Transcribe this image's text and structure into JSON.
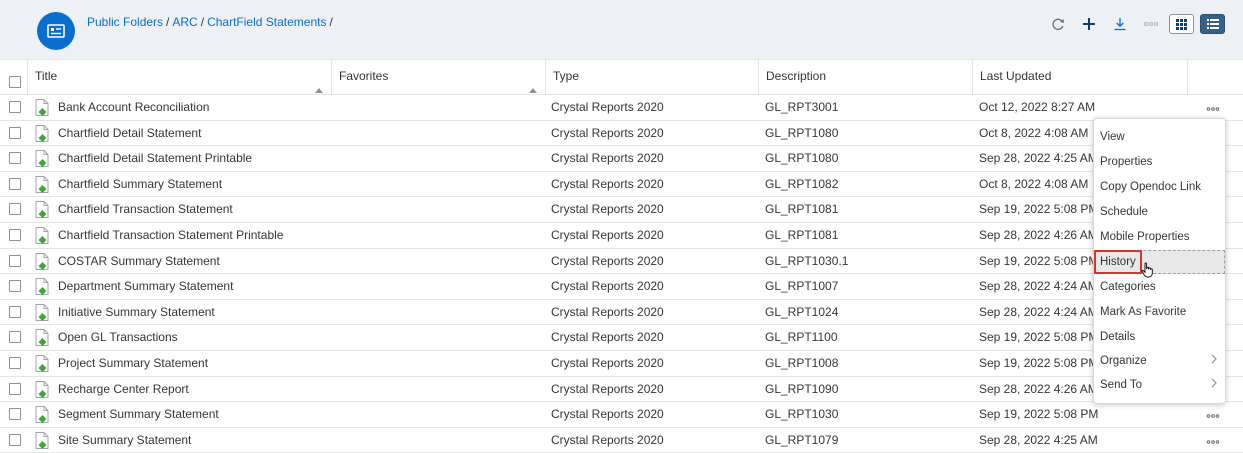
{
  "breadcrumb": {
    "items": [
      "Public Folders",
      "ARC",
      "ChartField Statements"
    ],
    "separator": "/"
  },
  "toolbar": {
    "icons": [
      "refresh-icon",
      "add-icon",
      "download-icon",
      "more-icon",
      "tile-view-icon",
      "list-view-icon"
    ]
  },
  "table": {
    "columns": [
      "Title",
      "Favorites",
      "Type",
      "Description",
      "Last Updated"
    ],
    "rows": [
      {
        "title": "Bank Account Reconciliation",
        "favorites": "",
        "type": "Crystal Reports 2020",
        "description": "GL_RPT3001",
        "updated": "Oct 12, 2022 8:27 AM"
      },
      {
        "title": "Chartfield Detail Statement",
        "favorites": "",
        "type": "Crystal Reports 2020",
        "description": "GL_RPT1080",
        "updated": "Oct 8, 2022 4:08 AM"
      },
      {
        "title": "Chartfield Detail Statement Printable",
        "favorites": "",
        "type": "Crystal Reports 2020",
        "description": "GL_RPT1080",
        "updated": "Sep 28, 2022 4:25 AM"
      },
      {
        "title": "Chartfield Summary Statement",
        "favorites": "",
        "type": "Crystal Reports 2020",
        "description": "GL_RPT1082",
        "updated": "Oct 8, 2022 4:08 AM"
      },
      {
        "title": "Chartfield Transaction Statement",
        "favorites": "",
        "type": "Crystal Reports 2020",
        "description": "GL_RPT1081",
        "updated": "Sep 19, 2022 5:08 PM"
      },
      {
        "title": "Chartfield Transaction Statement Printable",
        "favorites": "",
        "type": "Crystal Reports 2020",
        "description": "GL_RPT1081",
        "updated": "Sep 28, 2022 4:26 AM"
      },
      {
        "title": "COSTAR Summary Statement",
        "favorites": "",
        "type": "Crystal Reports 2020",
        "description": "GL_RPT1030.1",
        "updated": "Sep 19, 2022 5:08 PM"
      },
      {
        "title": "Department Summary Statement",
        "favorites": "",
        "type": "Crystal Reports 2020",
        "description": "GL_RPT1007",
        "updated": "Sep 28, 2022 4:24 AM"
      },
      {
        "title": "Initiative Summary Statement",
        "favorites": "",
        "type": "Crystal Reports 2020",
        "description": "GL_RPT1024",
        "updated": "Sep 28, 2022 4:24 AM"
      },
      {
        "title": "Open GL Transactions",
        "favorites": "",
        "type": "Crystal Reports 2020",
        "description": "GL_RPT1100",
        "updated": "Sep 19, 2022 5:08 PM"
      },
      {
        "title": "Project Summary Statement",
        "favorites": "",
        "type": "Crystal Reports 2020",
        "description": "GL_RPT1008",
        "updated": "Sep 19, 2022 5:08 PM"
      },
      {
        "title": "Recharge Center Report",
        "favorites": "",
        "type": "Crystal Reports 2020",
        "description": "GL_RPT1090",
        "updated": "Sep 28, 2022 4:26 AM"
      },
      {
        "title": "Segment Summary Statement",
        "favorites": "",
        "type": "Crystal Reports 2020",
        "description": "GL_RPT1030",
        "updated": "Sep 19, 2022 5:08 PM"
      },
      {
        "title": "Site Summary Statement",
        "favorites": "",
        "type": "Crystal Reports 2020",
        "description": "GL_RPT1079",
        "updated": "Sep 28, 2022 4:25 AM"
      }
    ],
    "more_rows": [
      0,
      12,
      13
    ]
  },
  "context_menu": {
    "items": [
      {
        "label": "View",
        "submenu": false
      },
      {
        "label": "Properties",
        "submenu": false
      },
      {
        "label": "Copy Opendoc Link",
        "submenu": false
      },
      {
        "label": "Schedule",
        "submenu": false
      },
      {
        "label": "Mobile Properties",
        "submenu": false
      },
      {
        "label": "History",
        "submenu": false,
        "highlighted": true
      },
      {
        "label": "Categories",
        "submenu": false
      },
      {
        "label": "Mark As Favorite",
        "submenu": false
      },
      {
        "label": "Details",
        "submenu": false
      },
      {
        "label": "Organize",
        "submenu": true
      },
      {
        "label": "Send To",
        "submenu": true
      }
    ]
  },
  "colors": {
    "accent": "#0a6ed1",
    "header_bg": "#edf1f5",
    "highlight": "#d9342b",
    "list_view_active": "#346187",
    "file_icon_green": "#3fa63a"
  }
}
